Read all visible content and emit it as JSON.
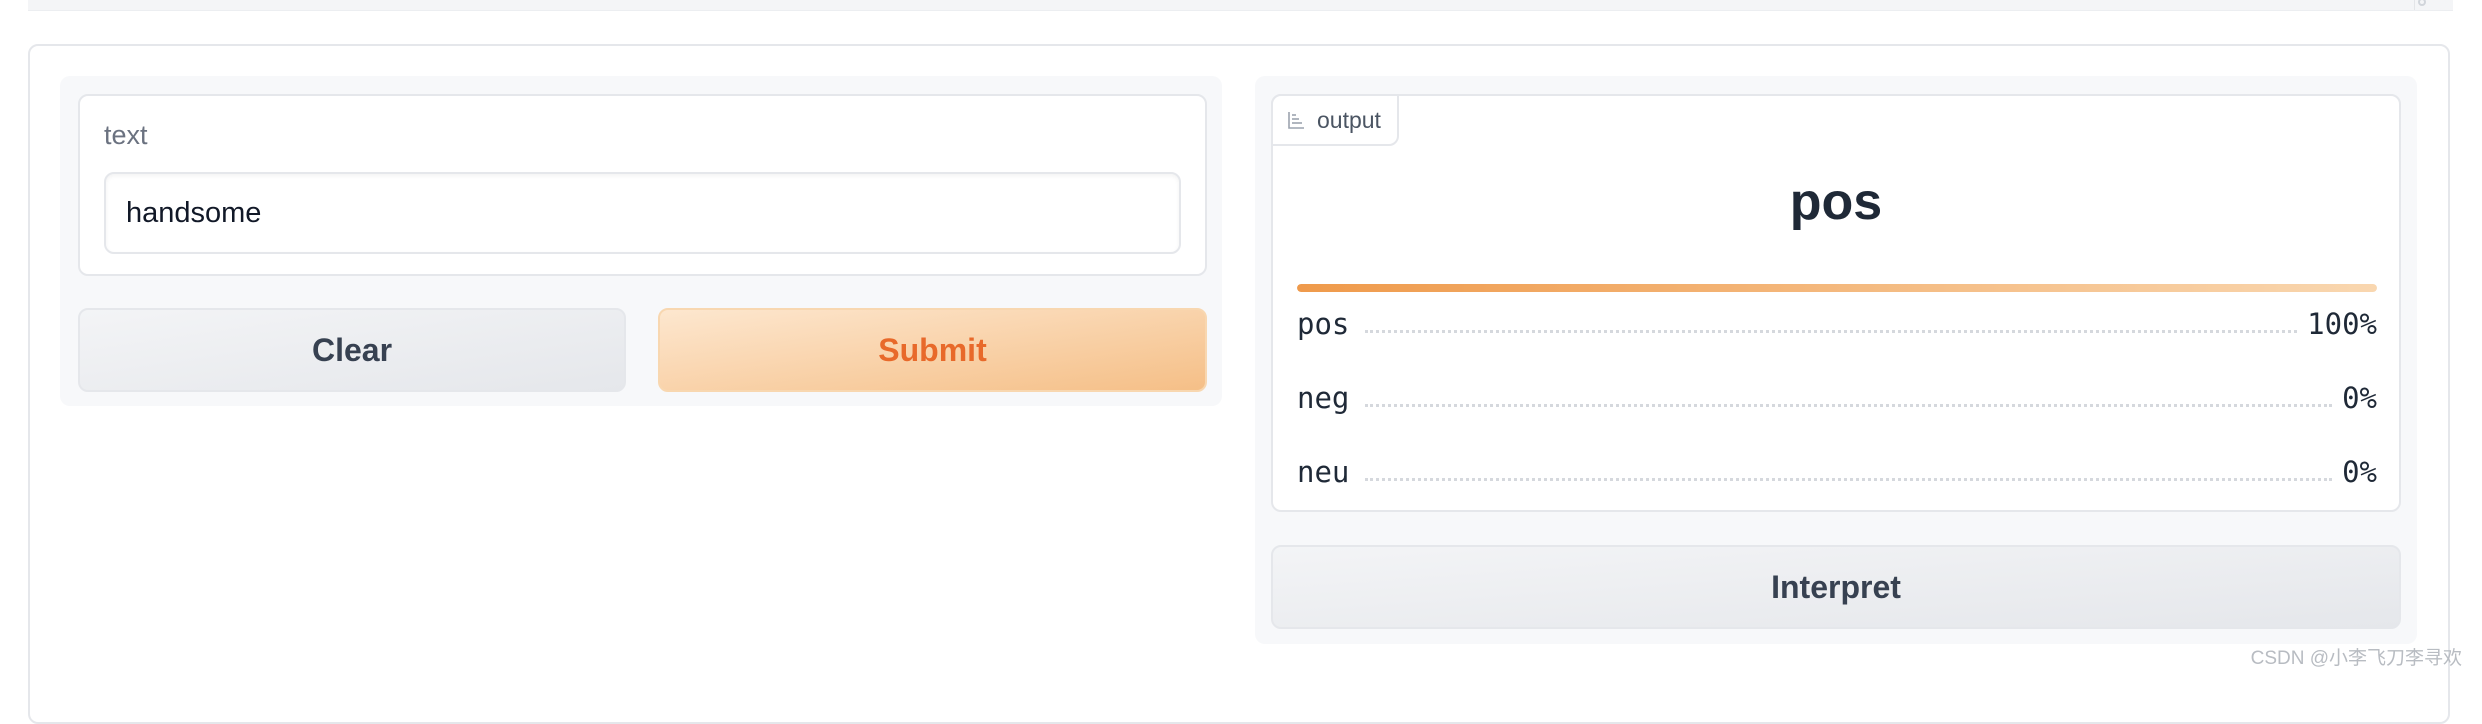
{
  "input": {
    "label": "text",
    "value": "handsome"
  },
  "buttons": {
    "clear": "Clear",
    "submit": "Submit",
    "interpret": "Interpret"
  },
  "output": {
    "tab_label": "output",
    "tab_icon": "bar-chart-icon",
    "top_label": "pos",
    "top_confidence": 1.0,
    "confidences": [
      {
        "label": "pos",
        "value": "100%"
      },
      {
        "label": "neg",
        "value": "0%"
      },
      {
        "label": "neu",
        "value": "0%"
      }
    ]
  },
  "watermark": "CSDN @小李飞刀李寻欢",
  "colors": {
    "accent_orange": "#e8692a",
    "submit_bg": "#f5bf87",
    "bar_start": "#ef9a4b"
  }
}
